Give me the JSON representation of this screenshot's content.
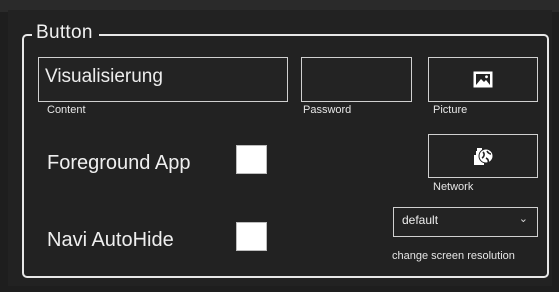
{
  "group": {
    "title": "Button"
  },
  "content": {
    "value": "Visualisierung",
    "label": "Content"
  },
  "password": {
    "value": "",
    "label": "Password"
  },
  "picture": {
    "label": "Picture",
    "icon": "image-icon"
  },
  "foreground_app": {
    "label": "Foreground App",
    "checked": false
  },
  "network": {
    "label": "Network",
    "icon": "network-globe-icon"
  },
  "navi_autohide": {
    "label": "Navi AutoHide",
    "checked": false
  },
  "resolution": {
    "selected": "default",
    "label": "change screen resolution"
  },
  "colors": {
    "background": "#1e1e1e",
    "panel": "#222222",
    "border": "#e8e8e8",
    "checkbox": "#ffffff",
    "text": "#ffffff"
  }
}
